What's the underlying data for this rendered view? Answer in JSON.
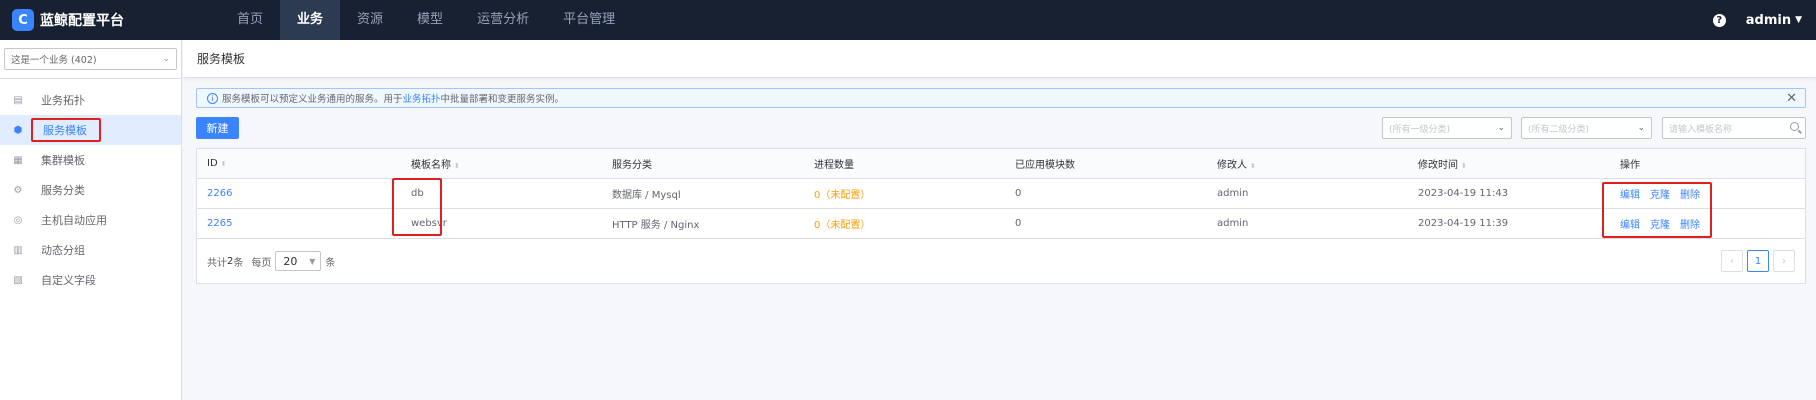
{
  "app": {
    "title": "蓝鲸配置平台",
    "logo_letter": "C"
  },
  "nav": {
    "items": [
      {
        "label": "首页",
        "active": false
      },
      {
        "label": "业务",
        "active": true
      },
      {
        "label": "资源",
        "active": false
      },
      {
        "label": "模型",
        "active": false
      },
      {
        "label": "运营分析",
        "active": false
      },
      {
        "label": "平台管理",
        "active": false
      }
    ],
    "help": "?",
    "user": "admin"
  },
  "sidebar": {
    "business_select": "这是一个业务 (402)",
    "items": [
      {
        "label": "业务拓扑",
        "icon": "topology-icon",
        "glyph": "▤"
      },
      {
        "label": "服务模板",
        "icon": "service-template-icon",
        "glyph": "⬢",
        "active": true
      },
      {
        "label": "集群模板",
        "icon": "cluster-template-icon",
        "glyph": "▦"
      },
      {
        "label": "服务分类",
        "icon": "service-category-icon",
        "glyph": "⚙"
      },
      {
        "label": "主机自动应用",
        "icon": "host-auto-apply-icon",
        "glyph": "◎"
      },
      {
        "label": "动态分组",
        "icon": "dynamic-group-icon",
        "glyph": "▥"
      },
      {
        "label": "自定义字段",
        "icon": "custom-field-icon",
        "glyph": "▧"
      }
    ]
  },
  "page": {
    "title": "服务模板",
    "notice": {
      "before": "服务模板可以预定义业务通用的服务。用于",
      "link": "业务拓扑",
      "after": "中批量部署和变更服务实例。"
    },
    "create_button": "新建",
    "filter1_placeholder": "(所有一级分类)",
    "filter2_placeholder": "(所有二级分类)",
    "search_placeholder": "请输入模板名称"
  },
  "table": {
    "columns": [
      "ID",
      "模板名称",
      "服务分类",
      "进程数量",
      "已应用模块数",
      "修改人",
      "修改时间",
      "操作"
    ],
    "rows": [
      {
        "id": "2266",
        "name": "db",
        "category": "数据库 / Mysql",
        "process": "0（未配置）",
        "modules": "0",
        "modifier": "admin",
        "time": "2023-04-19 11:43"
      },
      {
        "id": "2265",
        "name": "websvr",
        "category": "HTTP 服务 / Nginx",
        "process": "0（未配置）",
        "modules": "0",
        "modifier": "admin",
        "time": "2023-04-19 11:39"
      }
    ],
    "actions": {
      "edit": "编辑",
      "clone": "克隆",
      "delete": "删除"
    },
    "footer": {
      "total_prefix": "共计",
      "total": "2",
      "total_suffix": "条",
      "per_page": "每页",
      "page_size": "20",
      "unit": "条"
    },
    "pager": {
      "prev": "‹",
      "current": "1",
      "next": "›"
    }
  }
}
